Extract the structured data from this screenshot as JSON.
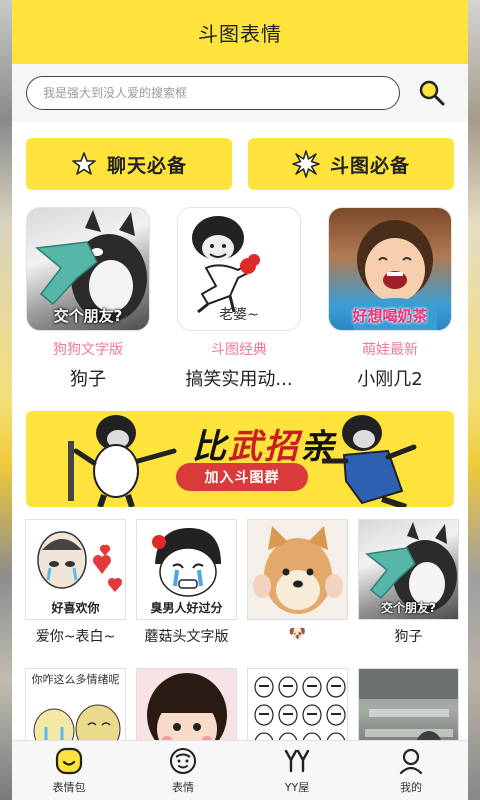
{
  "app": {
    "title": "斗图表情"
  },
  "search": {
    "placeholder": "我是强大到没人爱的搜索框"
  },
  "categories": [
    {
      "label": "聊天必备",
      "icon": "star-outline-icon"
    },
    {
      "label": "斗图必备",
      "icon": "burst-icon"
    }
  ],
  "featured": [
    {
      "caption": "交个朋友?",
      "tag": "狗狗文字版",
      "name": "狗子"
    },
    {
      "caption": "老婆~",
      "tag": "斗图经典",
      "name": "搞笑实用动..."
    },
    {
      "caption": "好想喝奶茶",
      "tag": "萌娃最新",
      "name": "小刚几2"
    }
  ],
  "banner": {
    "title_a": "比",
    "title_b": "武招",
    "title_c": "亲",
    "button": "加入斗图群"
  },
  "grid_row1": [
    {
      "caption": "好喜欢你",
      "name": "爱你~表白~"
    },
    {
      "caption": "臭男人好过分",
      "name": "蘑菇头文字版"
    },
    {
      "caption": "",
      "name": "🐶"
    },
    {
      "caption": "交个朋友?",
      "name": "狗子"
    }
  ],
  "grid_row2": [
    {
      "caption": "你咋这么多情绪呢"
    },
    {
      "caption": ""
    },
    {
      "caption": ""
    },
    {
      "caption": ""
    }
  ],
  "nav": [
    {
      "label": "表情包",
      "icon": "smile-face-icon",
      "active": true
    },
    {
      "label": "表情",
      "icon": "face-icon",
      "active": false
    },
    {
      "label": "YY屋",
      "icon": "yy-icon",
      "active": false
    },
    {
      "label": "我的",
      "icon": "person-icon",
      "active": false
    }
  ],
  "colors": {
    "accent": "#fde33b",
    "tag_pink": "#f3789a",
    "banner_red": "#d93a3a"
  }
}
